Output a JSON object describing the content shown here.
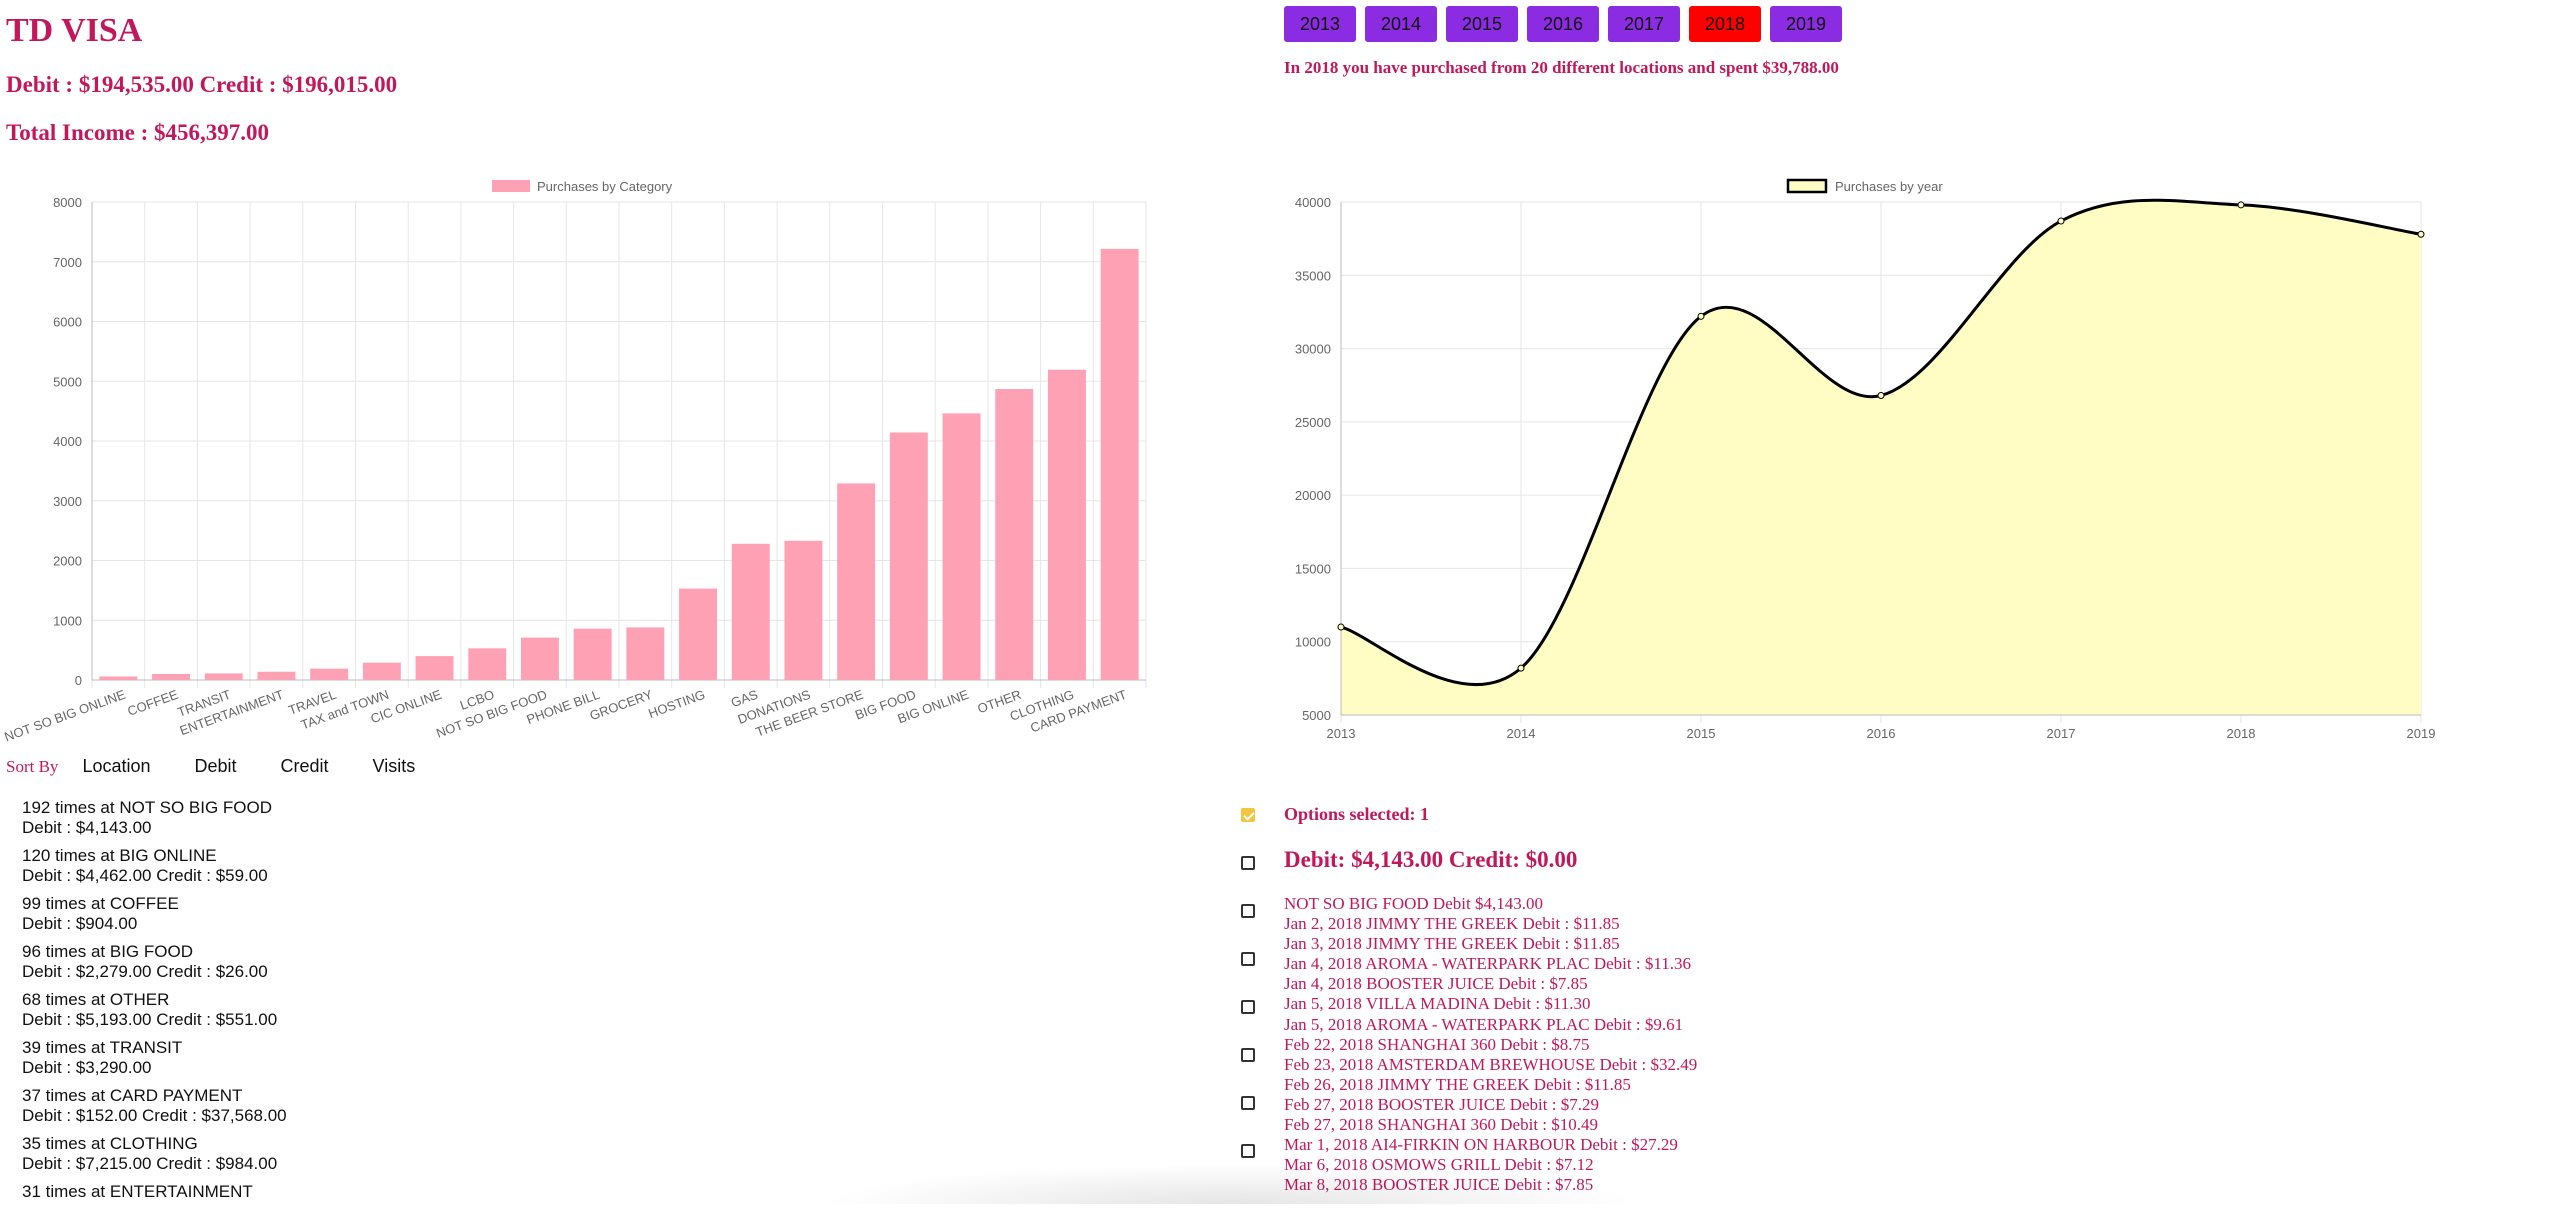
{
  "header": {
    "title": "TD VISA",
    "debit_credit": "Debit : $194,535.00 Credit : $196,015.00",
    "total_income": "Total Income : $456,397.00"
  },
  "years": {
    "buttons": [
      "2013",
      "2014",
      "2015",
      "2016",
      "2017",
      "2018",
      "2019"
    ],
    "active": "2018",
    "message": "In 2018 you have purchased from 20 different locations and spent $39,788.00"
  },
  "colors": {
    "accent": "#c2185b",
    "year_button": "#8b2be2",
    "year_button_active": "#ff0000",
    "bar_fill": "#ffa1b5",
    "area_fill": "#fffcc4",
    "checkbox_checked": "#f4c542"
  },
  "chart_data": [
    {
      "type": "bar",
      "legend": "Purchases by Category",
      "legend_position": "top",
      "categories": [
        "NOT SO BIG ONLINE",
        "COFFEE",
        "TRANSIT",
        "ENTERTAINMENT",
        "TRAVEL",
        "TAX and TOWN",
        "CIC ONLINE",
        "LCBO",
        "NOT SO BIG FOOD",
        "PHONE BILL",
        "GROCERY",
        "HOSTING",
        "GAS",
        "DONATIONS",
        "THE BEER STORE",
        "BIG FOOD",
        "BIG ONLINE",
        "OTHER",
        "CLOTHING",
        "CARD PAYMENT"
      ],
      "values": [
        59,
        101,
        110,
        138,
        190,
        290,
        400,
        530,
        710,
        860,
        880,
        1530,
        2279,
        2330,
        3290,
        4143,
        4462,
        4870,
        5193,
        7215
      ],
      "ylim": [
        0,
        8000
      ],
      "yticks": [
        0,
        1000,
        2000,
        3000,
        4000,
        5000,
        6000,
        7000,
        8000
      ],
      "grid": true
    },
    {
      "type": "area",
      "legend": "Purchases by year",
      "legend_position": "top",
      "x": [
        "2013",
        "2014",
        "2015",
        "2016",
        "2017",
        "2018",
        "2019"
      ],
      "values": [
        11000,
        8200,
        32200,
        26800,
        38700,
        39800,
        37800
      ],
      "ylim": [
        5000,
        40000
      ],
      "yticks": [
        5000,
        10000,
        15000,
        20000,
        25000,
        30000,
        35000,
        40000
      ],
      "grid": true
    }
  ],
  "sort": {
    "label": "Sort By",
    "options": [
      "Location",
      "Debit",
      "Credit",
      "Visits"
    ]
  },
  "locations": [
    {
      "visits": "192 times at NOT SO BIG FOOD",
      "amounts": "Debit : $4,143.00"
    },
    {
      "visits": "120 times at BIG ONLINE",
      "amounts": "Debit : $4,462.00 Credit : $59.00"
    },
    {
      "visits": "99 times at COFFEE",
      "amounts": "Debit : $904.00"
    },
    {
      "visits": "96 times at BIG FOOD",
      "amounts": "Debit : $2,279.00 Credit : $26.00"
    },
    {
      "visits": "68 times at OTHER",
      "amounts": "Debit : $5,193.00 Credit : $551.00"
    },
    {
      "visits": "39 times at TRANSIT",
      "amounts": "Debit : $3,290.00"
    },
    {
      "visits": "37 times at CARD PAYMENT",
      "amounts": "Debit : $152.00 Credit : $37,568.00"
    },
    {
      "visits": "35 times at CLOTHING",
      "amounts": "Debit : $7,215.00 Credit : $984.00"
    },
    {
      "visits": "31 times at ENTERTAINMENT",
      "amounts": ""
    }
  ],
  "selection": {
    "options_selected": "Options selected: 1",
    "totals": "Debit: $4,143.00 Credit: $0.00",
    "lines": [
      "NOT SO BIG FOOD Debit $4,143.00",
      "Jan 2, 2018 JIMMY THE GREEK Debit : $11.85",
      "Jan 3, 2018 JIMMY THE GREEK Debit : $11.85",
      "Jan 4, 2018 AROMA - WATERPARK PLAC Debit : $11.36",
      "Jan 4, 2018 BOOSTER JUICE Debit : $7.85",
      "Jan 5, 2018 VILLA MADINA Debit : $11.30",
      "Jan 5, 2018 AROMA - WATERPARK PLAC Debit : $9.61",
      "Feb 22, 2018 SHANGHAI 360 Debit : $8.75",
      "Feb 23, 2018 AMSTERDAM BREWHOUSE Debit : $32.49",
      "Feb 26, 2018 JIMMY THE GREEK Debit : $11.85",
      "Feb 27, 2018 BOOSTER JUICE Debit : $7.29",
      "Feb 27, 2018 SHANGHAI 360 Debit : $10.49",
      "Mar 1, 2018 AI4-FIRKIN ON HARBOUR Debit : $27.29",
      "Mar 6, 2018 OSMOWS GRILL Debit : $7.12",
      "Mar 8, 2018 BOOSTER JUICE Debit : $7.85"
    ]
  }
}
